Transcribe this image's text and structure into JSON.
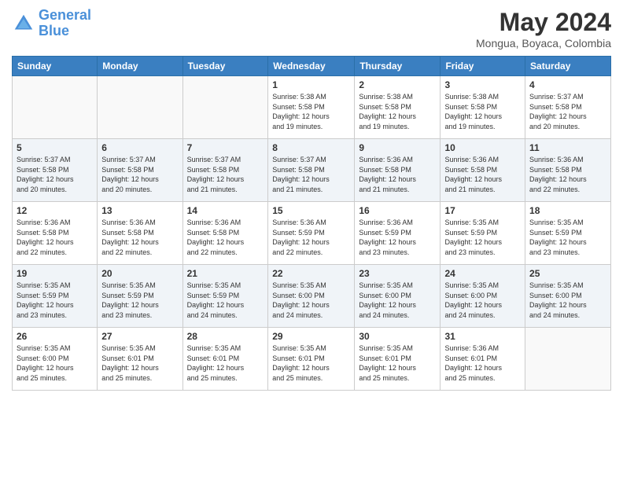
{
  "header": {
    "logo_line1": "General",
    "logo_line2": "Blue",
    "main_title": "May 2024",
    "subtitle": "Mongua, Boyaca, Colombia"
  },
  "days_of_week": [
    "Sunday",
    "Monday",
    "Tuesday",
    "Wednesday",
    "Thursday",
    "Friday",
    "Saturday"
  ],
  "weeks": [
    {
      "shade": false,
      "days": [
        {
          "num": "",
          "info": ""
        },
        {
          "num": "",
          "info": ""
        },
        {
          "num": "",
          "info": ""
        },
        {
          "num": "1",
          "info": "Sunrise: 5:38 AM\nSunset: 5:58 PM\nDaylight: 12 hours\nand 19 minutes."
        },
        {
          "num": "2",
          "info": "Sunrise: 5:38 AM\nSunset: 5:58 PM\nDaylight: 12 hours\nand 19 minutes."
        },
        {
          "num": "3",
          "info": "Sunrise: 5:38 AM\nSunset: 5:58 PM\nDaylight: 12 hours\nand 19 minutes."
        },
        {
          "num": "4",
          "info": "Sunrise: 5:37 AM\nSunset: 5:58 PM\nDaylight: 12 hours\nand 20 minutes."
        }
      ]
    },
    {
      "shade": true,
      "days": [
        {
          "num": "5",
          "info": "Sunrise: 5:37 AM\nSunset: 5:58 PM\nDaylight: 12 hours\nand 20 minutes."
        },
        {
          "num": "6",
          "info": "Sunrise: 5:37 AM\nSunset: 5:58 PM\nDaylight: 12 hours\nand 20 minutes."
        },
        {
          "num": "7",
          "info": "Sunrise: 5:37 AM\nSunset: 5:58 PM\nDaylight: 12 hours\nand 21 minutes."
        },
        {
          "num": "8",
          "info": "Sunrise: 5:37 AM\nSunset: 5:58 PM\nDaylight: 12 hours\nand 21 minutes."
        },
        {
          "num": "9",
          "info": "Sunrise: 5:36 AM\nSunset: 5:58 PM\nDaylight: 12 hours\nand 21 minutes."
        },
        {
          "num": "10",
          "info": "Sunrise: 5:36 AM\nSunset: 5:58 PM\nDaylight: 12 hours\nand 21 minutes."
        },
        {
          "num": "11",
          "info": "Sunrise: 5:36 AM\nSunset: 5:58 PM\nDaylight: 12 hours\nand 22 minutes."
        }
      ]
    },
    {
      "shade": false,
      "days": [
        {
          "num": "12",
          "info": "Sunrise: 5:36 AM\nSunset: 5:58 PM\nDaylight: 12 hours\nand 22 minutes."
        },
        {
          "num": "13",
          "info": "Sunrise: 5:36 AM\nSunset: 5:58 PM\nDaylight: 12 hours\nand 22 minutes."
        },
        {
          "num": "14",
          "info": "Sunrise: 5:36 AM\nSunset: 5:58 PM\nDaylight: 12 hours\nand 22 minutes."
        },
        {
          "num": "15",
          "info": "Sunrise: 5:36 AM\nSunset: 5:59 PM\nDaylight: 12 hours\nand 22 minutes."
        },
        {
          "num": "16",
          "info": "Sunrise: 5:36 AM\nSunset: 5:59 PM\nDaylight: 12 hours\nand 23 minutes."
        },
        {
          "num": "17",
          "info": "Sunrise: 5:35 AM\nSunset: 5:59 PM\nDaylight: 12 hours\nand 23 minutes."
        },
        {
          "num": "18",
          "info": "Sunrise: 5:35 AM\nSunset: 5:59 PM\nDaylight: 12 hours\nand 23 minutes."
        }
      ]
    },
    {
      "shade": true,
      "days": [
        {
          "num": "19",
          "info": "Sunrise: 5:35 AM\nSunset: 5:59 PM\nDaylight: 12 hours\nand 23 minutes."
        },
        {
          "num": "20",
          "info": "Sunrise: 5:35 AM\nSunset: 5:59 PM\nDaylight: 12 hours\nand 23 minutes."
        },
        {
          "num": "21",
          "info": "Sunrise: 5:35 AM\nSunset: 5:59 PM\nDaylight: 12 hours\nand 24 minutes."
        },
        {
          "num": "22",
          "info": "Sunrise: 5:35 AM\nSunset: 6:00 PM\nDaylight: 12 hours\nand 24 minutes."
        },
        {
          "num": "23",
          "info": "Sunrise: 5:35 AM\nSunset: 6:00 PM\nDaylight: 12 hours\nand 24 minutes."
        },
        {
          "num": "24",
          "info": "Sunrise: 5:35 AM\nSunset: 6:00 PM\nDaylight: 12 hours\nand 24 minutes."
        },
        {
          "num": "25",
          "info": "Sunrise: 5:35 AM\nSunset: 6:00 PM\nDaylight: 12 hours\nand 24 minutes."
        }
      ]
    },
    {
      "shade": false,
      "days": [
        {
          "num": "26",
          "info": "Sunrise: 5:35 AM\nSunset: 6:00 PM\nDaylight: 12 hours\nand 25 minutes."
        },
        {
          "num": "27",
          "info": "Sunrise: 5:35 AM\nSunset: 6:01 PM\nDaylight: 12 hours\nand 25 minutes."
        },
        {
          "num": "28",
          "info": "Sunrise: 5:35 AM\nSunset: 6:01 PM\nDaylight: 12 hours\nand 25 minutes."
        },
        {
          "num": "29",
          "info": "Sunrise: 5:35 AM\nSunset: 6:01 PM\nDaylight: 12 hours\nand 25 minutes."
        },
        {
          "num": "30",
          "info": "Sunrise: 5:35 AM\nSunset: 6:01 PM\nDaylight: 12 hours\nand 25 minutes."
        },
        {
          "num": "31",
          "info": "Sunrise: 5:36 AM\nSunset: 6:01 PM\nDaylight: 12 hours\nand 25 minutes."
        },
        {
          "num": "",
          "info": ""
        }
      ]
    }
  ]
}
